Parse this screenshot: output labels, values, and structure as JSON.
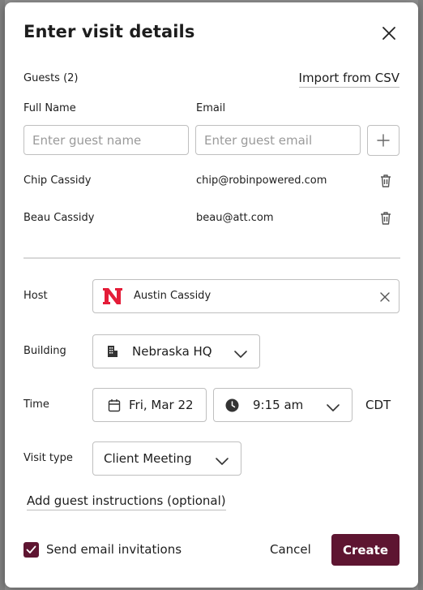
{
  "modal": {
    "title": "Enter visit details"
  },
  "guests": {
    "heading": "Guests (2)",
    "import_link": "Import from CSV",
    "col_full_name": "Full Name",
    "col_email": "Email",
    "name_placeholder": "Enter guest name",
    "email_placeholder": "Enter guest email",
    "list": [
      {
        "name": "Chip Cassidy",
        "email": "chip@robinpowered.com"
      },
      {
        "name": "Beau Cassidy",
        "email": "beau@att.com"
      }
    ]
  },
  "host": {
    "label": "Host",
    "name": "Austin Cassidy"
  },
  "building": {
    "label": "Building",
    "value": "Nebraska HQ"
  },
  "time": {
    "label": "Time",
    "date": "Fri, Mar 22",
    "time": "9:15 am",
    "timezone": "CDT"
  },
  "visit_type": {
    "label": "Visit type",
    "value": "Client Meeting"
  },
  "instructions_link": "Add guest instructions (optional)",
  "footer": {
    "send_invites_label": "Send email invitations",
    "send_invites_checked": true,
    "cancel_label": "Cancel",
    "create_label": "Create"
  },
  "colors": {
    "primary": "#5e1531",
    "host_logo": "#e41c38"
  },
  "icons": [
    "close-icon",
    "plus-icon",
    "trash-icon",
    "clear-icon",
    "building-icon",
    "chevron-down-icon",
    "calendar-icon",
    "clock-icon",
    "check-icon"
  ]
}
